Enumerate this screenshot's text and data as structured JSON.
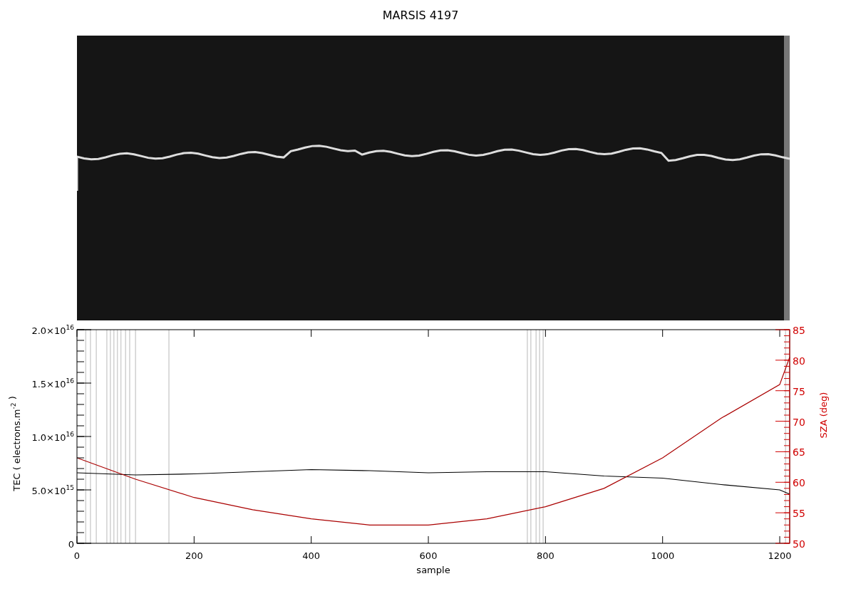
{
  "title": "MARSIS 4197",
  "radargram": {
    "kind": "image"
  },
  "plot": {
    "chart_data": {
      "type": "line",
      "xlabel": "sample",
      "ylabel": "TEC ( electrons.m$^{-2}$ )",
      "y2label": "SZA (deg)",
      "x": [
        0,
        100,
        200,
        300,
        400,
        500,
        600,
        700,
        800,
        900,
        1000,
        1100,
        1200,
        1217
      ],
      "xlim": [
        0,
        1217
      ],
      "ylim": [
        0,
        2e+16
      ],
      "y2lim": [
        50,
        85
      ],
      "xticks": [
        0,
        200,
        400,
        600,
        800,
        1000,
        1200
      ],
      "yticks": [
        {
          "value": 0,
          "label": "0"
        },
        {
          "value": 5000000000000000.0,
          "label": "5.0×10$^{15}$"
        },
        {
          "value": 1e+16,
          "label": "1.0×10$^{16}$"
        },
        {
          "value": 1.5e+16,
          "label": "1.5×10$^{16}$"
        },
        {
          "value": 2e+16,
          "label": "2.0×10$^{16}$"
        }
      ],
      "y2ticks": [
        50,
        55,
        60,
        65,
        70,
        75,
        80,
        85
      ],
      "series": [
        {
          "color": "#000000",
          "values": [
            6600000000000000.0,
            6400000000000000.0,
            6500000000000000.0,
            6700000000000000.0,
            6900000000000000.0,
            6800000000000000.0,
            6600000000000000.0,
            6700000000000000.0,
            6700000000000000.0,
            6300000000000000.0,
            6100000000000000.0,
            5500000000000000.0,
            5000000000000000.0,
            4600000000000000.0
          ]
        },
        {
          "color": "#aa0000",
          "axis": "y2",
          "values": [
            64,
            60.5,
            57.5,
            55.5,
            54,
            53,
            53,
            54,
            56,
            59,
            64,
            70.5,
            76,
            80.5
          ]
        }
      ],
      "ref_lines": [
        {
          "axis": "x",
          "value": 15
        },
        {
          "axis": "x",
          "value": 23
        },
        {
          "axis": "x",
          "value": 33
        },
        {
          "axis": "x",
          "value": 51
        },
        {
          "axis": "x",
          "value": 57
        },
        {
          "axis": "x",
          "value": 63
        },
        {
          "axis": "x",
          "value": 69
        },
        {
          "axis": "x",
          "value": 75
        },
        {
          "axis": "x",
          "value": 83
        },
        {
          "axis": "x",
          "value": 90
        },
        {
          "axis": "x",
          "value": 100
        },
        {
          "axis": "x",
          "value": 157
        },
        {
          "axis": "x",
          "value": 769
        },
        {
          "axis": "x",
          "value": 775
        },
        {
          "axis": "x",
          "value": 784
        },
        {
          "axis": "x",
          "value": 790
        },
        {
          "axis": "x",
          "value": 796
        },
        {
          "axis": "x",
          "value": 1210
        }
      ]
    }
  }
}
